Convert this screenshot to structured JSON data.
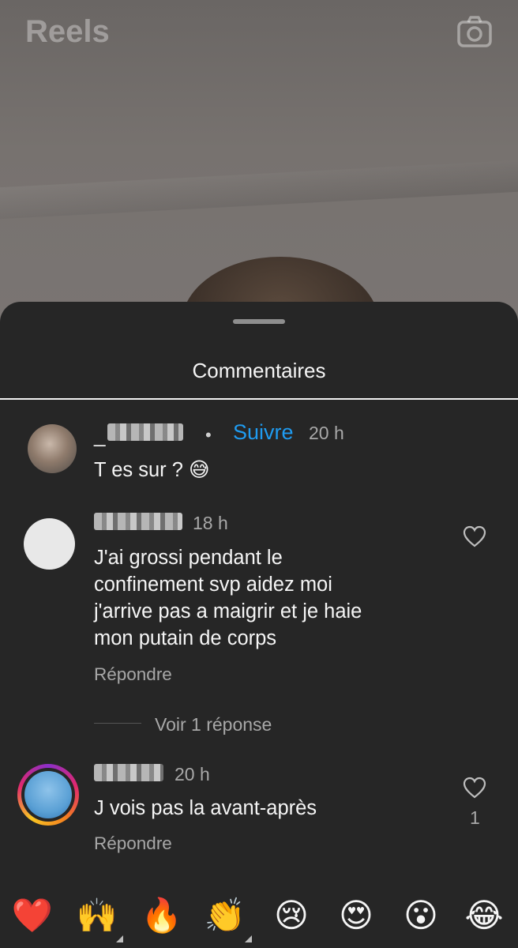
{
  "header": {
    "title": "Reels",
    "camera_icon": "camera-icon"
  },
  "sheet": {
    "title": "Commentaires"
  },
  "comments": [
    {
      "username": "_",
      "follow_label": "Suivre",
      "separator": "•",
      "time": "20 h",
      "text": "T es sur ? 😅"
    },
    {
      "time": "18 h",
      "text_lines": [
        "J'ai grossi pendant le",
        "confinement svp aidez moi",
        "j'arrive pas a maigrir et je haie",
        "mon putain de corps"
      ],
      "reply_label": "Répondre",
      "view_replies": "Voir 1 réponse"
    },
    {
      "time": "20 h",
      "text": "J vois pas la avant-après",
      "reply_label": "Répondre",
      "like_count": "1"
    }
  ],
  "emoji_bar": [
    "❤️",
    "🙌",
    "🔥",
    "👏",
    "😢",
    "😍",
    "😮",
    "😂"
  ],
  "colors": {
    "accent": "#1f9bf0",
    "sheet_bg": "#262626",
    "muted": "#a8a8a8"
  }
}
